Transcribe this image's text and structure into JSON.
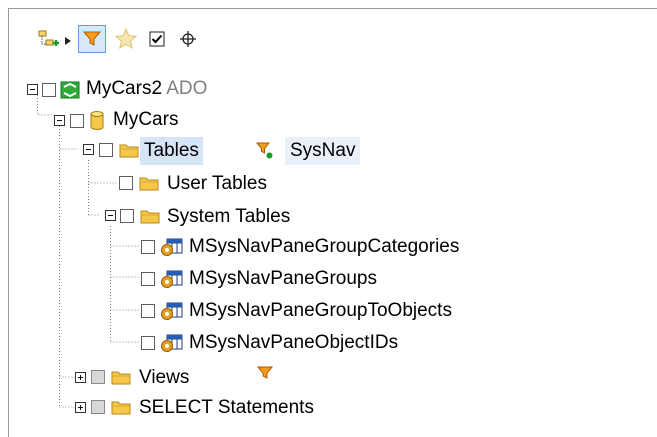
{
  "toolbar": {
    "icons": [
      "add-node-icon",
      "arrow-icon",
      "filter-icon",
      "favorites-icon",
      "checkbox-icon",
      "locate-icon"
    ]
  },
  "tree": {
    "root": {
      "label": "MyCars2",
      "suffix": "ADO"
    },
    "database": {
      "label": "MyCars"
    },
    "tables": {
      "label": "Tables",
      "filter_text": "SysNav"
    },
    "user_tables": {
      "label": "User Tables"
    },
    "system_tables": {
      "label": "System Tables"
    },
    "sys_items": [
      "MSysNavPaneGroupCategories",
      "MSysNavPaneGroups",
      "MSysNavPaneGroupToObjects",
      "MSysNavPaneObjectIDs"
    ],
    "views": {
      "label": "Views"
    },
    "select_statements": {
      "label": "SELECT Statements"
    }
  },
  "colors": {
    "selection": "#d6e4f7",
    "folder": "#f5c84c",
    "filter": "#f59a00",
    "datasource": "#2faa3b"
  }
}
